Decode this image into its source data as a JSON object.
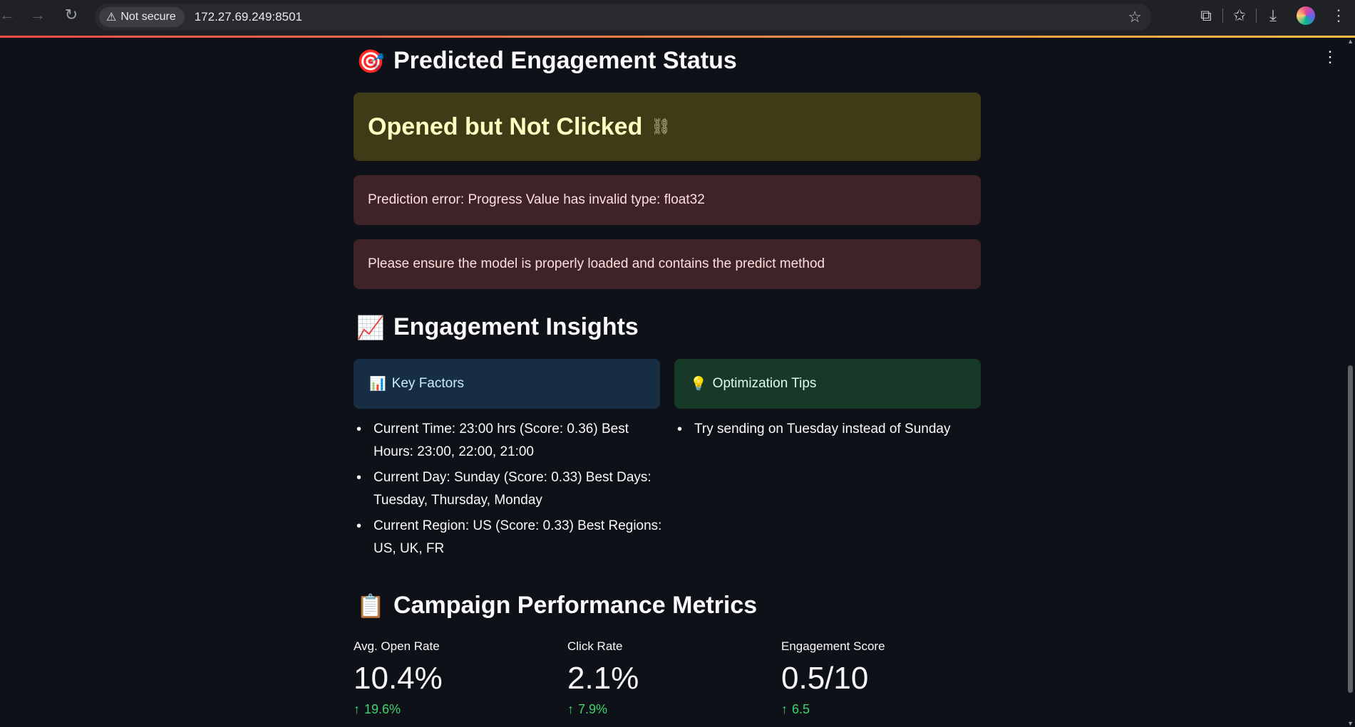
{
  "browser": {
    "security_label": "Not secure",
    "url": "172.27.69.249:8501"
  },
  "sections": {
    "status": {
      "emoji": "🎯",
      "title": "Predicted Engagement Status",
      "prediction": "Opened but Not Clicked",
      "errors": [
        "Prediction error: Progress Value has invalid type: float32",
        "Please ensure the model is properly loaded and contains the predict method"
      ]
    },
    "insights": {
      "emoji": "📈",
      "title": "Engagement Insights",
      "key_factors": {
        "emoji": "📊",
        "label": "Key Factors",
        "items": [
          "Current Time: 23:00 hrs (Score: 0.36) Best Hours: 23:00, 22:00, 21:00",
          "Current Day: Sunday (Score: 0.33) Best Days: Tuesday, Thursday, Monday",
          "Current Region: US (Score: 0.33) Best Regions: US, UK, FR"
        ]
      },
      "tips": {
        "emoji": "💡",
        "label": "Optimization Tips",
        "items": [
          "Try sending on Tuesday instead of Sunday"
        ]
      }
    },
    "metrics": {
      "emoji": "📋",
      "title": "Campaign Performance Metrics",
      "items": [
        {
          "label": "Avg. Open Rate",
          "value": "10.4%",
          "delta": "19.6%"
        },
        {
          "label": "Click Rate",
          "value": "2.1%",
          "delta": "7.9%"
        },
        {
          "label": "Engagement Score",
          "value": "0.5/10",
          "delta": "6.5"
        }
      ]
    }
  }
}
